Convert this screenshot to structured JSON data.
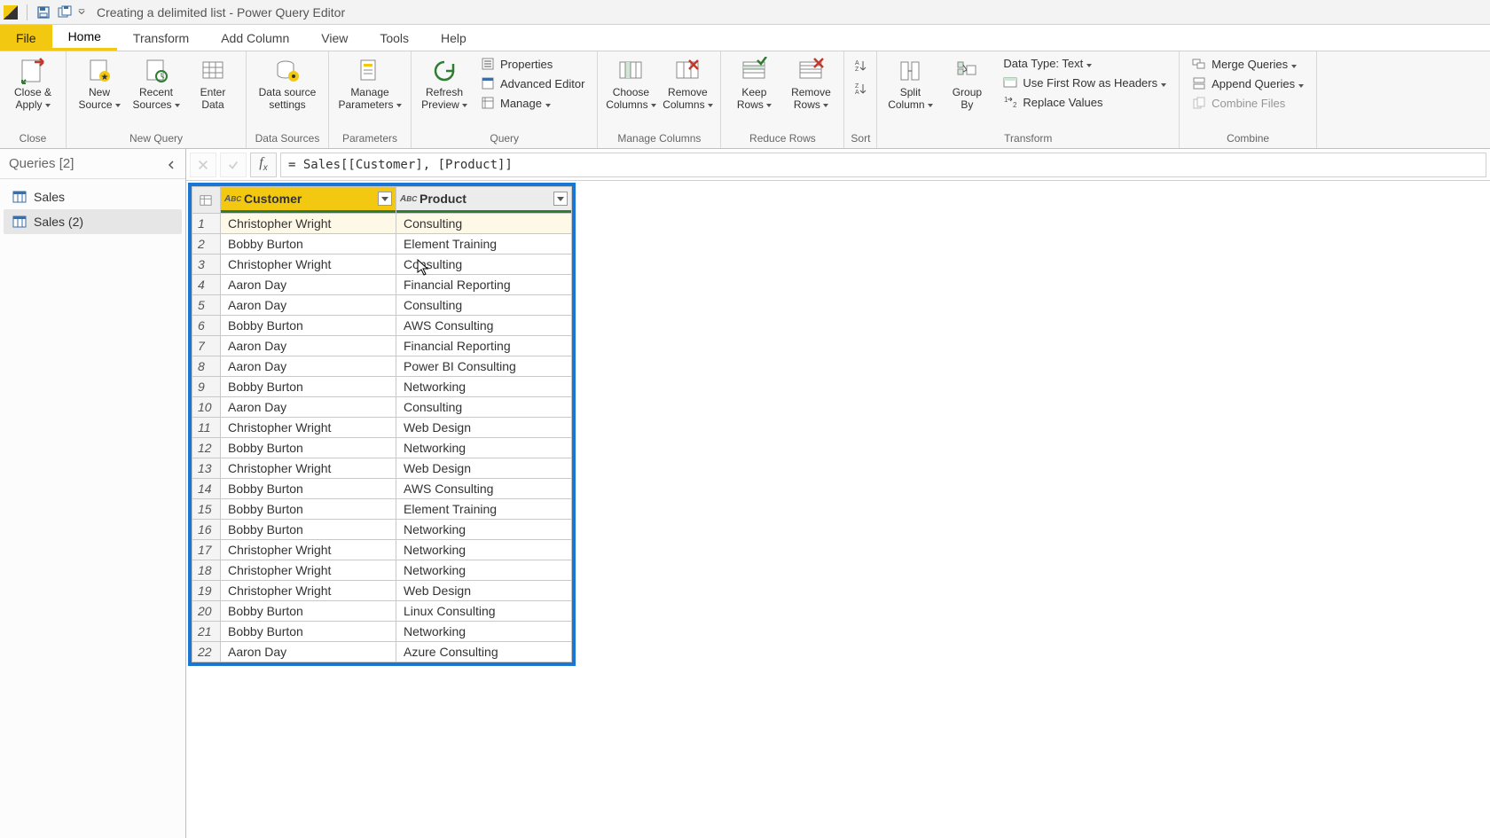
{
  "title": "Creating a delimited list - Power Query Editor",
  "tabs": {
    "file": "File",
    "home": "Home",
    "transform": "Transform",
    "addcolumn": "Add Column",
    "view": "View",
    "tools": "Tools",
    "help": "Help"
  },
  "ribbon": {
    "close": {
      "closeapply": "Close &\nApply",
      "group": "Close"
    },
    "newquery": {
      "newsource": "New\nSource",
      "recent": "Recent\nSources",
      "enter": "Enter\nData",
      "group": "New Query"
    },
    "datasources": {
      "settings": "Data source\nsettings",
      "group": "Data Sources"
    },
    "parameters": {
      "manage": "Manage\nParameters",
      "group": "Parameters"
    },
    "query": {
      "refresh": "Refresh\nPreview",
      "properties": "Properties",
      "advanced": "Advanced Editor",
      "managebtn": "Manage",
      "group": "Query"
    },
    "managecols": {
      "choose": "Choose\nColumns",
      "remove": "Remove\nColumns",
      "group": "Manage Columns"
    },
    "reducerows": {
      "keep": "Keep\nRows",
      "removerows": "Remove\nRows",
      "group": "Reduce Rows"
    },
    "sort": {
      "group": "Sort"
    },
    "transform": {
      "split": "Split\nColumn",
      "groupby": "Group\nBy",
      "datatype": "Data Type: Text",
      "firstrow": "Use First Row as Headers",
      "replace": "Replace Values",
      "group": "Transform"
    },
    "combine": {
      "merge": "Merge Queries",
      "append": "Append Queries",
      "combinefiles": "Combine Files",
      "group": "Combine"
    }
  },
  "queries": {
    "title": "Queries [2]",
    "items": [
      "Sales",
      "Sales (2)"
    ]
  },
  "formula": "= Sales[[Customer], [Product]]",
  "columns": [
    "Customer",
    "Product"
  ],
  "rows": [
    [
      "Christopher Wright",
      "Consulting"
    ],
    [
      "Bobby Burton",
      "Element Training"
    ],
    [
      "Christopher Wright",
      "Consulting"
    ],
    [
      "Aaron Day",
      "Financial Reporting"
    ],
    [
      "Aaron Day",
      "Consulting"
    ],
    [
      "Bobby Burton",
      "AWS Consulting"
    ],
    [
      "Aaron Day",
      "Financial Reporting"
    ],
    [
      "Aaron Day",
      "Power BI Consulting"
    ],
    [
      "Bobby Burton",
      "Networking"
    ],
    [
      "Aaron Day",
      "Consulting"
    ],
    [
      "Christopher Wright",
      "Web Design"
    ],
    [
      "Bobby Burton",
      "Networking"
    ],
    [
      "Christopher Wright",
      "Web Design"
    ],
    [
      "Bobby Burton",
      "AWS Consulting"
    ],
    [
      "Bobby Burton",
      "Element Training"
    ],
    [
      "Bobby Burton",
      "Networking"
    ],
    [
      "Christopher Wright",
      "Networking"
    ],
    [
      "Christopher Wright",
      "Networking"
    ],
    [
      "Christopher Wright",
      "Web Design"
    ],
    [
      "Bobby Burton",
      "Linux Consulting"
    ],
    [
      "Bobby Burton",
      "Networking"
    ],
    [
      "Aaron Day",
      "Azure Consulting"
    ]
  ]
}
